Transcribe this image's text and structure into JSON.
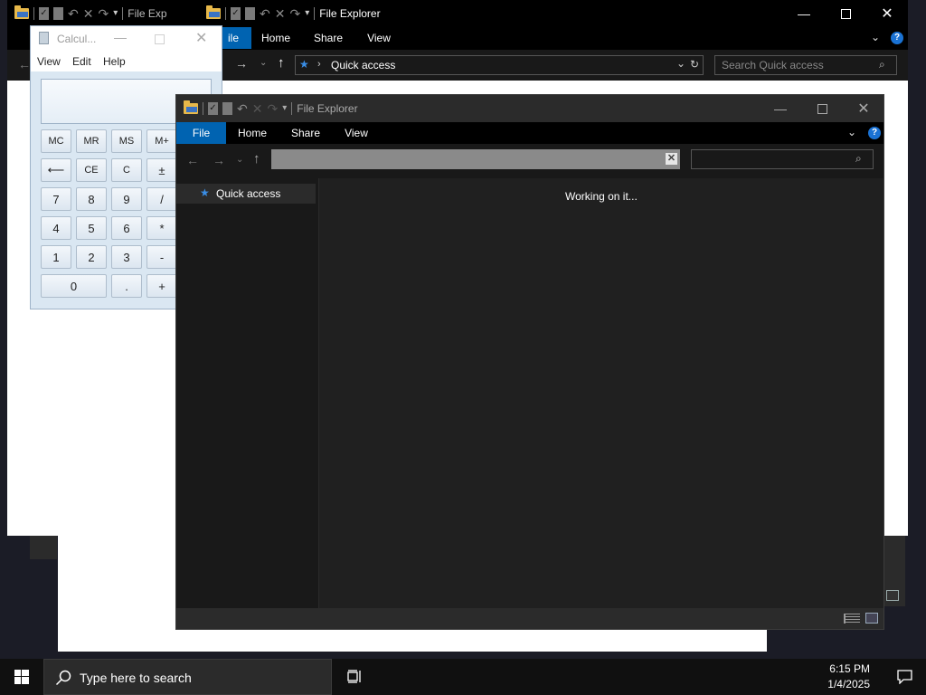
{
  "colors": {
    "accent": "#0063b1",
    "explorer_bg": "#191919",
    "explorer_pane": "#202020",
    "help_blue": "#1a72d4"
  },
  "back_explorer": {
    "title_partial": "File Exp",
    "title": "File Explorer",
    "ribbon_tabs": [
      "ile",
      "Home",
      "Share",
      "View"
    ],
    "path": "Quick access",
    "search_placeholder": "Search Quick access",
    "help": "?"
  },
  "calculator": {
    "title": "Calcul...",
    "menu": [
      "View",
      "Edit",
      "Help"
    ],
    "display": "",
    "memory_row": [
      "MC",
      "MR",
      "MS",
      "M+"
    ],
    "row1": [
      "⟵",
      "CE",
      "C",
      "±"
    ],
    "row2": [
      "7",
      "8",
      "9",
      "/"
    ],
    "row3": [
      "4",
      "5",
      "6",
      "*"
    ],
    "row4": [
      "1",
      "2",
      "3",
      "-"
    ],
    "row5": [
      "0",
      ".",
      "+"
    ]
  },
  "front_explorer": {
    "title": "File Explorer",
    "ribbon_tabs": [
      "File",
      "Home",
      "Share",
      "View"
    ],
    "address_value": "",
    "search_value": "",
    "nav_items": [
      "Quick access"
    ],
    "status": "Working on it...",
    "help": "?"
  },
  "taskbar": {
    "search_placeholder": "Type here to search",
    "time": "6:15 PM",
    "date": "1/4/2025"
  },
  "icons": [
    "windows-start-icon",
    "search-icon",
    "task-view-icon",
    "notification-icon",
    "folder-icon",
    "star-icon",
    "up-arrow-icon",
    "back-arrow-icon",
    "forward-arrow-icon",
    "refresh-icon",
    "close-icon",
    "minimize-icon",
    "maximize-icon"
  ]
}
